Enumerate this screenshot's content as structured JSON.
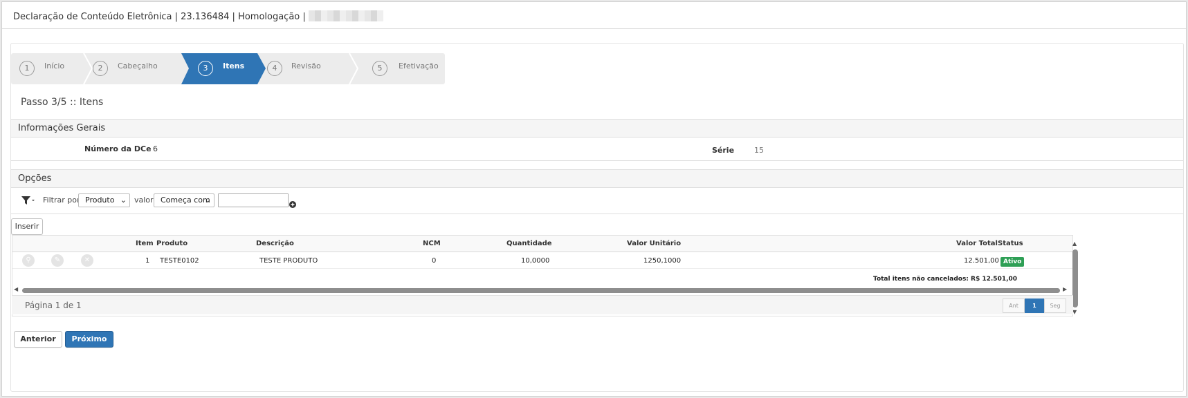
{
  "window": {
    "title": "Declaração de Conteúdo Eletrônica | 23.136484 | Homologação |"
  },
  "wizard": {
    "steps": [
      {
        "num": "1",
        "label": "Início"
      },
      {
        "num": "2",
        "label": "Cabeçalho"
      },
      {
        "num": "3",
        "label": "Itens"
      },
      {
        "num": "4",
        "label": "Revisão"
      },
      {
        "num": "5",
        "label": "Efetivação"
      }
    ],
    "active_index": 2,
    "step_title": "Passo 3/5 :: Itens"
  },
  "info": {
    "heading": "Informações Gerais",
    "numero_label": "Número da DCe",
    "numero_value": "6",
    "serie_label": "Série",
    "serie_value": "15"
  },
  "options": {
    "heading": "Opções",
    "filter_by_label": "Filtrar por",
    "filter_by_value": "Produto",
    "value_label": "valor",
    "operator_value": "Começa com",
    "search_value": ""
  },
  "toolbar": {
    "insert_label": "Inserir"
  },
  "grid": {
    "columns": [
      "Item",
      "Produto",
      "Descrição",
      "NCM",
      "Quantidade",
      "Valor Unitário",
      "Valor Total",
      "Status"
    ],
    "rows": [
      {
        "item": "1",
        "produto": "TESTE0102",
        "descricao": "TESTE PRODUTO",
        "ncm": "0",
        "quantidade": "10,0000",
        "valor_unitario": "1250,1000",
        "valor_total": "12.501,00",
        "status": "Ativo"
      }
    ],
    "total_label": "Total itens não cancelados: R$ 12.501,00",
    "status_color": "#2e9f55"
  },
  "pager": {
    "label": "Página 1 de 1",
    "prev": "Ant",
    "current": "1",
    "next": "Seg"
  },
  "footer": {
    "back_label": "Anterior",
    "next_label": "Próximo"
  },
  "colors": {
    "accent": "#2f75b5"
  }
}
